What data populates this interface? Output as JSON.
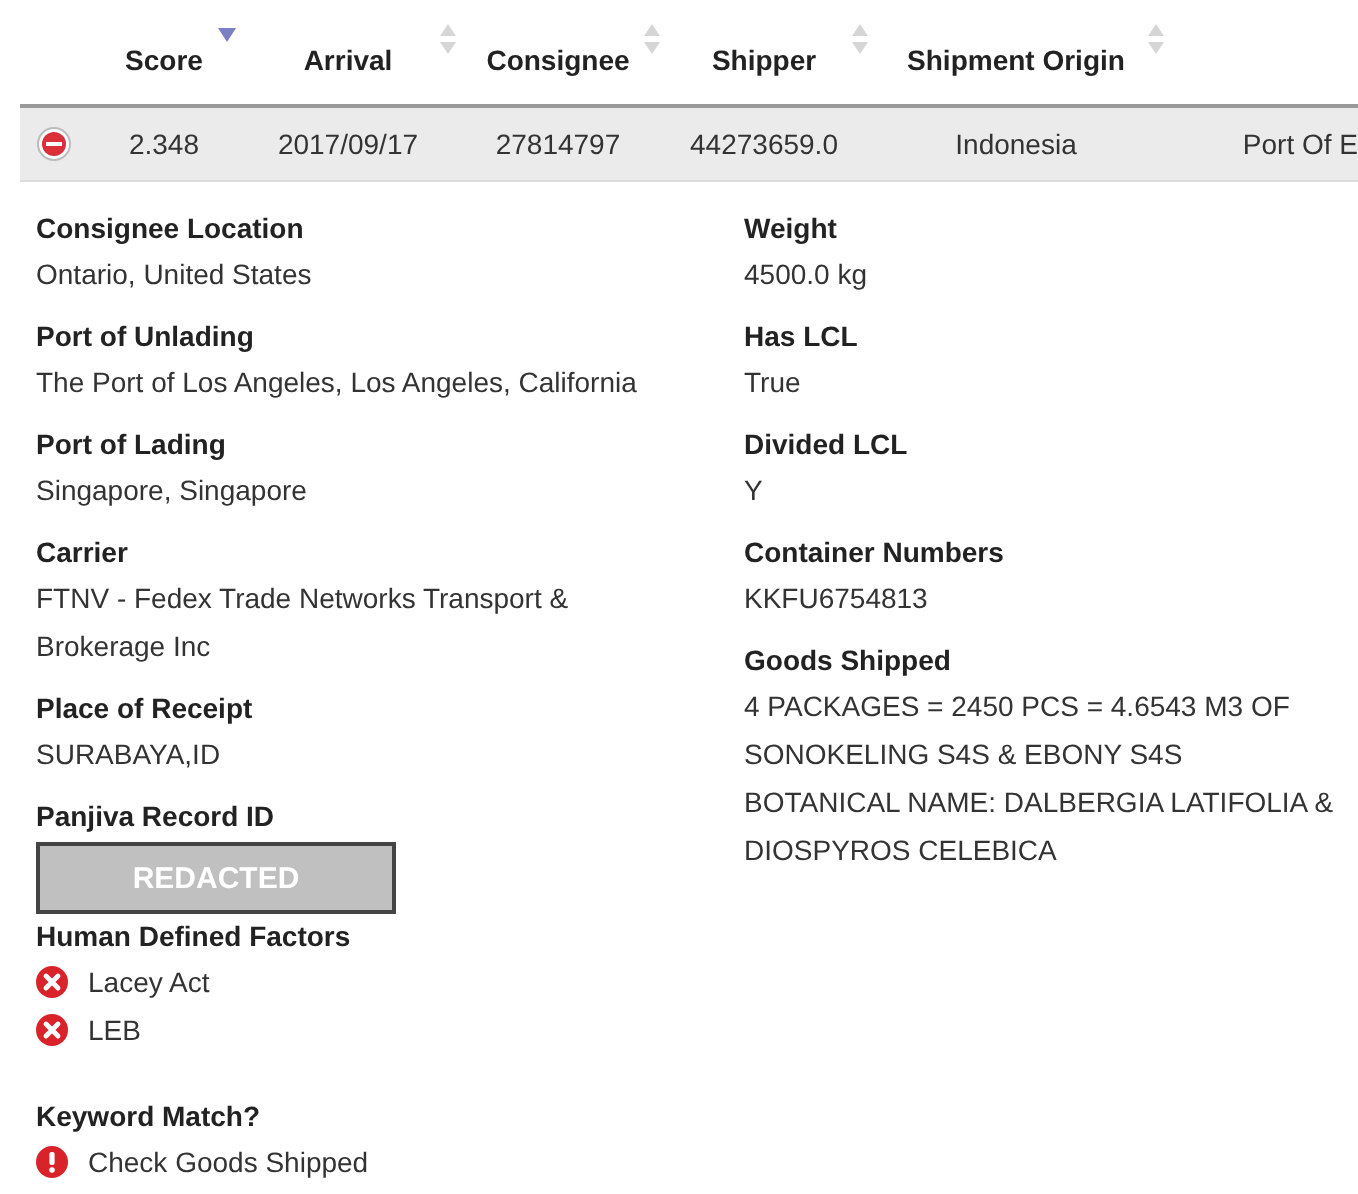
{
  "table": {
    "columns": [
      {
        "label": "Score",
        "sorted": true
      },
      {
        "label": "Arrival",
        "sorted": false
      },
      {
        "label": "Consignee",
        "sorted": false
      },
      {
        "label": "Shipper",
        "sorted": false
      },
      {
        "label": "Shipment Origin",
        "sorted": false
      }
    ],
    "rows": [
      {
        "expanded": true,
        "cells": [
          "2.348",
          "2017/09/17",
          "27814797",
          "44273659.0",
          "Indonesia",
          "Port Of E"
        ]
      }
    ]
  },
  "details": {
    "left": [
      {
        "label": "Consignee Location",
        "kind": "text",
        "value": "Ontario, United States"
      },
      {
        "label": "Port of Unlading",
        "kind": "text",
        "value": "The Port of Los Angeles, Los Angeles, California"
      },
      {
        "label": "Port of Lading",
        "kind": "text",
        "value": "Singapore, Singapore"
      },
      {
        "label": "Carrier",
        "kind": "text",
        "value": "FTNV - Fedex Trade Networks Transport & Brokerage Inc"
      },
      {
        "label": "Place of Receipt",
        "kind": "text",
        "value": "SURABAYA,ID"
      },
      {
        "label": "Panjiva Record ID",
        "kind": "redacted",
        "value": "REDACTED"
      },
      {
        "label": "Human Defined Factors",
        "kind": "factors",
        "items": [
          "Lacey Act",
          "LEB"
        ]
      },
      {
        "label": "Keyword Match?",
        "kind": "alerts",
        "items": [
          "Check Goods Shipped"
        ]
      }
    ],
    "right": [
      {
        "label": "Weight",
        "kind": "text",
        "value": "4500.0 kg"
      },
      {
        "label": "Has LCL",
        "kind": "text",
        "value": "True"
      },
      {
        "label": "Divided LCL",
        "kind": "text",
        "value": "Y"
      },
      {
        "label": "Container Numbers",
        "kind": "text",
        "value": "KKFU6754813"
      },
      {
        "label": "Goods Shipped",
        "kind": "text",
        "value": "4 PACKAGES = 2450 PCS = 4.6543 M3 OF SONOKELING S4S & EBONY S4S BOTANICAL NAME: DALBERGIA LATIFOLIA & DIOSPYROS CELEBICA"
      }
    ]
  }
}
